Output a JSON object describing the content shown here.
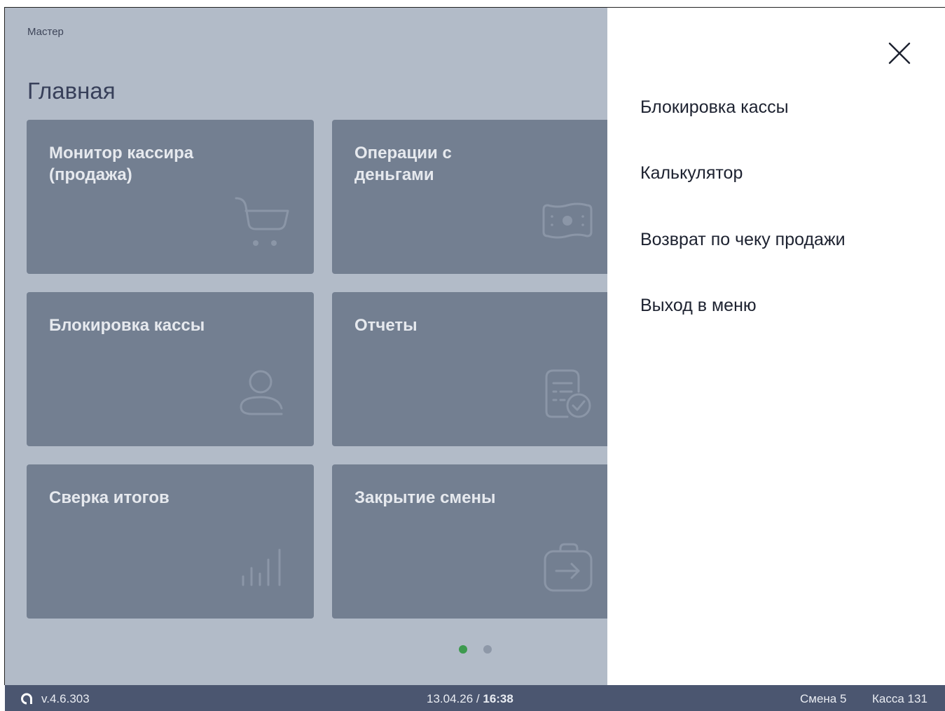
{
  "main": {
    "breadcrumb": "Мастер",
    "title": "Главная",
    "tiles": [
      {
        "label": "Монитор кассира\n(продажа)",
        "icon": "cart-icon"
      },
      {
        "label": "Операции с\nденьгами",
        "icon": "money-icon"
      },
      {
        "label": "Блокировка кассы",
        "icon": "user-icon"
      },
      {
        "label": "Отчеты",
        "icon": "report-icon"
      },
      {
        "label": "Сверка итогов",
        "icon": "bar-chart-icon"
      },
      {
        "label": "Закрытие смены",
        "icon": "exit-icon"
      }
    ],
    "pager": {
      "pages": 2,
      "current": 1
    }
  },
  "side_menu": {
    "items": [
      {
        "label": "Блокировка кассы"
      },
      {
        "label": "Калькулятор"
      },
      {
        "label": "Возврат по чеку продажи"
      },
      {
        "label": "Выход в меню"
      }
    ]
  },
  "statusbar": {
    "version": "v.4.6.303",
    "date": "13.04.26",
    "separator": " / ",
    "time": "16:38",
    "shift": "Смена 5",
    "register": "Касса 131"
  },
  "colors": {
    "main_bg": "#b2bbc8",
    "tile_bg": "#737f91",
    "statusbar_bg": "#4b5670",
    "dot_active": "#3d9a4f",
    "dot_inactive": "#8e98a8"
  }
}
